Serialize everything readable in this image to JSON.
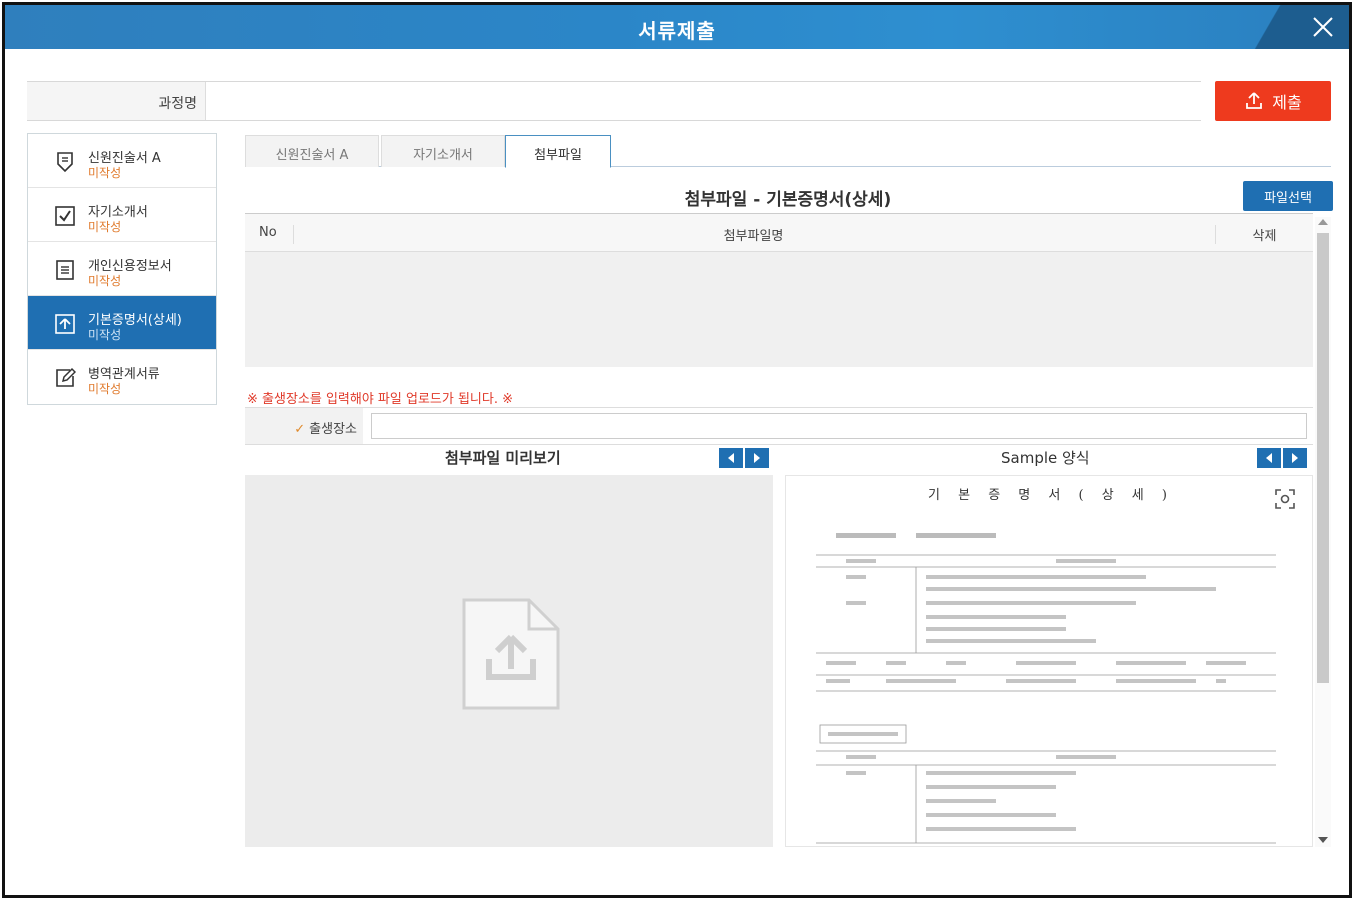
{
  "window": {
    "title": "서류제출"
  },
  "course": {
    "label": "과정명",
    "value": ""
  },
  "submit": {
    "label": "제출"
  },
  "sidebar": {
    "items": [
      {
        "name": "신원진술서 A",
        "status": "미작성",
        "icon": "shield-doc-icon",
        "active": false
      },
      {
        "name": "자기소개서",
        "status": "미작성",
        "icon": "checkbox-icon",
        "active": false
      },
      {
        "name": "개인신용정보서",
        "status": "미작성",
        "icon": "list-doc-icon",
        "active": false
      },
      {
        "name": "기본증명서(상세)",
        "status": "미작성",
        "icon": "upload-box-icon",
        "active": true
      },
      {
        "name": "병역관계서류",
        "status": "미작성",
        "icon": "edit-icon",
        "active": false
      }
    ]
  },
  "tabs": [
    {
      "label": "신원진술서 A",
      "active": false
    },
    {
      "label": "자기소개서",
      "active": false
    },
    {
      "label": "첨부파일",
      "active": true
    }
  ],
  "attachments": {
    "title": "첨부파일 - 기본증명서(상세)",
    "file_select_label": "파일선택",
    "columns": {
      "no": "No",
      "name": "첨부파일명",
      "delete": "삭제"
    },
    "rows": []
  },
  "notice": "※ 출생장소를 입력해야 파일 업로드가 됩니다. ※",
  "birth_place": {
    "label": "출생장소",
    "value": ""
  },
  "preview": {
    "title": "첨부파일 미리보기"
  },
  "sample": {
    "title": "Sample 양식",
    "doc_title": "기 본 증 명 서 ( 상 세 )"
  },
  "colors": {
    "primary": "#1f6fb2",
    "submit": "#ee3a1e",
    "status": "#e07a2c",
    "notice": "#e03a2a"
  }
}
